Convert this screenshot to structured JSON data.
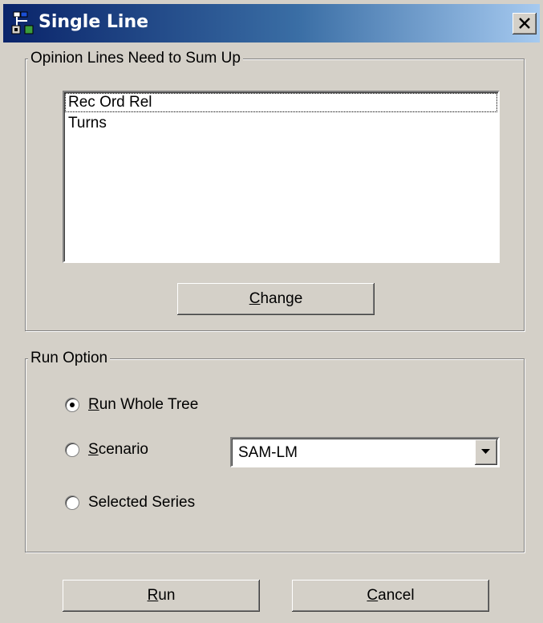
{
  "window": {
    "title": "Single Line",
    "close_label": "Close"
  },
  "opinion_group": {
    "legend": "Opinion Lines Need to Sum Up",
    "items": [
      {
        "label": "Rec Ord Rel",
        "focused": true
      },
      {
        "label": "Turns",
        "focused": false
      }
    ],
    "change_button": {
      "mnemonic": "C",
      "rest": "hange"
    }
  },
  "run_option_group": {
    "legend": "Run Option",
    "options": [
      {
        "mnemonic": "R",
        "rest": "un Whole Tree",
        "selected": true
      },
      {
        "mnemonic": "S",
        "rest": "cenario",
        "selected": false
      },
      {
        "label": "Selected Series",
        "selected": false
      }
    ],
    "scenario_combo": {
      "value": "SAM-LM"
    }
  },
  "footer": {
    "run_button": {
      "mnemonic": "R",
      "rest": "un"
    },
    "cancel_button": {
      "mnemonic": "C",
      "rest": "ancel"
    }
  },
  "icons": {
    "app": "tree-network-icon",
    "close": "close-x-icon",
    "dropdown": "triangle-down-icon"
  },
  "colors": {
    "titlebar_start": "#0a246a",
    "titlebar_end": "#a6caf0",
    "face": "#d4d0c8"
  }
}
